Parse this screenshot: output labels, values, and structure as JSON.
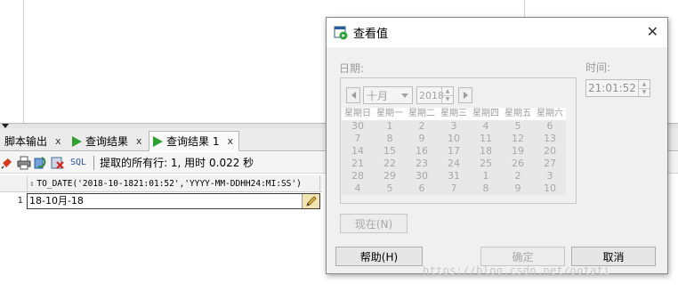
{
  "tabs": [
    {
      "label": "脚本输出",
      "close": "x",
      "active": false,
      "icon": "script-output-icon"
    },
    {
      "label": "查询结果",
      "close": "x",
      "active": false,
      "icon": "run-triangle-icon"
    },
    {
      "label": "查询结果 1",
      "close": "x",
      "active": true,
      "icon": "run-triangle-icon"
    }
  ],
  "toolbar": {
    "icons": [
      "pin-icon",
      "print-icon",
      "refresh-icon",
      "delete-icon"
    ],
    "sql_label": "SQL",
    "fetch_status": "提取的所有行: 1, 用时 0.022 秒"
  },
  "grid": {
    "column_header": "TO_DATE('2018-10-1821:01:52','YYYY-MM-DDHH24:MI:SS')",
    "rows": [
      {
        "num": "1",
        "value": "18-10月-18"
      }
    ]
  },
  "dialog": {
    "title": "查看值",
    "close": "✕",
    "date_label": "日期:",
    "time_label": "时间:",
    "month": "十月",
    "year": "2018",
    "time": "21:01:52",
    "weekdays": [
      "星期日",
      "星期一",
      "星期二",
      "星期三",
      "星期四",
      "星期五",
      "星期六"
    ],
    "days": [
      "30",
      "1",
      "2",
      "3",
      "4",
      "5",
      "6",
      "7",
      "8",
      "9",
      "10",
      "11",
      "12",
      "13",
      "14",
      "15",
      "16",
      "17",
      "18",
      "19",
      "20",
      "21",
      "22",
      "23",
      "24",
      "25",
      "26",
      "27",
      "28",
      "29",
      "30",
      "31",
      "1",
      "2",
      "3",
      "4",
      "5",
      "6",
      "7",
      "8",
      "9",
      "10"
    ],
    "now_button": "现在(N)",
    "help_button": "帮助(H)",
    "ok_button": "确定",
    "cancel_button": "取消"
  },
  "watermark": "https://blog.csdn.net/ootati"
}
